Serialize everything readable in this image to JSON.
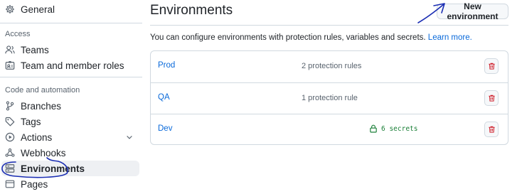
{
  "sidebar": {
    "general": "General",
    "access_label": "Access",
    "teams": "Teams",
    "team_roles": "Team and member roles",
    "code_label": "Code and automation",
    "branches": "Branches",
    "tags": "Tags",
    "actions": "Actions",
    "webhooks": "Webhooks",
    "environments": "Environments",
    "pages": "Pages"
  },
  "main": {
    "title": "Environments",
    "new_button": "New environment",
    "description": "You can configure environments with protection rules, variables and secrets.",
    "learn_more": "Learn more.",
    "environments": [
      {
        "name": "Prod",
        "info": "2 protection rules",
        "secrets": ""
      },
      {
        "name": "QA",
        "info": "1 protection rule",
        "secrets": ""
      },
      {
        "name": "Dev",
        "info": "",
        "secrets": "6 secrets"
      }
    ]
  },
  "colors": {
    "accent_link": "#0969da",
    "danger": "#cf222e",
    "success": "#1a7f37",
    "annotation_ink": "#1a2db3"
  },
  "icons": [
    "gear-icon",
    "person-icon",
    "id-badge-icon",
    "git-branch-icon",
    "tag-icon",
    "play-icon",
    "chevron-down-icon",
    "webhook-icon",
    "server-icon",
    "browser-icon",
    "lock-icon",
    "trash-icon"
  ]
}
